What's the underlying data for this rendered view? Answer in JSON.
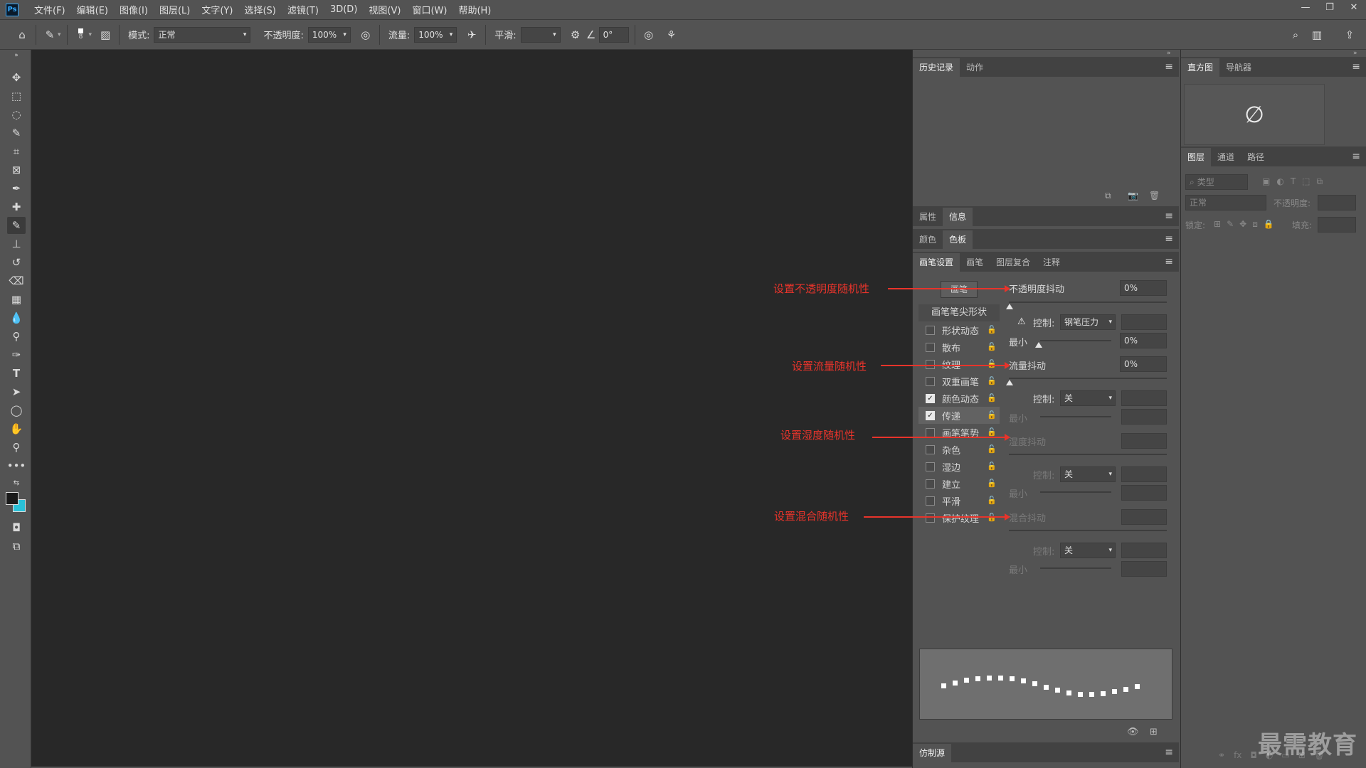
{
  "menubar": {
    "logo": "Ps",
    "items": [
      "文件(F)",
      "编辑(E)",
      "图像(I)",
      "图层(L)",
      "文字(Y)",
      "选择(S)",
      "滤镜(T)",
      "3D(D)",
      "视图(V)",
      "窗口(W)",
      "帮助(H)"
    ],
    "window_controls": [
      "—",
      "❐",
      "✕"
    ]
  },
  "options": {
    "brush_size": "8",
    "mode_label": "模式:",
    "mode_value": "正常",
    "opacity_label": "不透明度:",
    "opacity_value": "100%",
    "flow_label": "流量:",
    "flow_value": "100%",
    "smoothing_label": "平滑:",
    "smoothing_value": "",
    "angle_value": "0°"
  },
  "history_panel": {
    "tabs": [
      "历史记录",
      "动作"
    ]
  },
  "props_panel": {
    "tabs": [
      "属性",
      "信息"
    ]
  },
  "color_panel": {
    "tabs": [
      "颜色",
      "色板"
    ]
  },
  "brush_settings": {
    "tabs": [
      "画笔设置",
      "画笔",
      "图层复合",
      "注释"
    ],
    "brush_button": "画笔",
    "tip_shape": "画笔笔尖形状",
    "options": [
      {
        "label": "形状动态",
        "checked": false
      },
      {
        "label": "散布",
        "checked": false
      },
      {
        "label": "纹理",
        "checked": false
      },
      {
        "label": "双重画笔",
        "checked": false
      },
      {
        "label": "颜色动态",
        "checked": true
      },
      {
        "label": "传递",
        "checked": true
      },
      {
        "label": "画笔笔势",
        "checked": false
      },
      {
        "label": "杂色",
        "checked": false
      },
      {
        "label": "湿边",
        "checked": false
      },
      {
        "label": "建立",
        "checked": false
      },
      {
        "label": "平滑",
        "checked": false
      },
      {
        "label": "保护纹理",
        "checked": false
      }
    ],
    "opacity_jitter_label": "不透明度抖动",
    "opacity_jitter_value": "0%",
    "control_label": "控制:",
    "control1_value": "钢笔压力",
    "min_label": "最小",
    "min1_value": "0%",
    "flow_jitter_label": "流量抖动",
    "flow_jitter_value": "0%",
    "control2_value": "关",
    "wet_jitter_label": "湿度抖动",
    "control3_value": "关",
    "mix_jitter_label": "混合抖动",
    "control4_value": "关"
  },
  "clone_panel": {
    "tabs": [
      "仿制源"
    ]
  },
  "histogram_panel": {
    "tabs": [
      "直方图",
      "导航器"
    ],
    "icon": "∅"
  },
  "layers_panel": {
    "tabs": [
      "图层",
      "通道",
      "路径"
    ],
    "search_placeholder": "类型",
    "blend_mode": "正常",
    "opacity_label": "不透明度:",
    "lock_label": "锁定:",
    "fill_label": "填充:"
  },
  "annotations": [
    "设置不透明度随机性",
    "设置流量随机性",
    "设置湿度随机性",
    "设置混合随机性"
  ],
  "watermark": "最需教育",
  "colors": {
    "accent_red": "#e8342b",
    "foreground": "#1a1a1a",
    "background_swatch": "#29c1d8"
  }
}
